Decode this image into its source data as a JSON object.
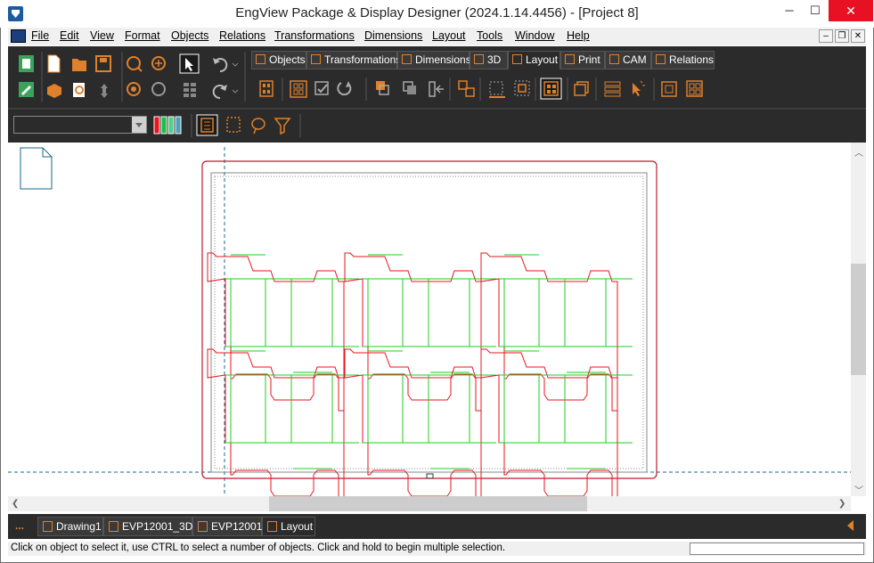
{
  "window": {
    "title": "EngView Package & Display Designer (2024.1.14.4456) - [Project 8]",
    "minimize": "─",
    "maximize": "☐",
    "close": "✕"
  },
  "menu": {
    "items": [
      "File",
      "Edit",
      "View",
      "Format",
      "Objects",
      "Relations",
      "Transformations",
      "Dimensions",
      "Layout",
      "Tools",
      "Window",
      "Help"
    ],
    "mdi_minimize": "–",
    "mdi_restore": "❐",
    "mdi_close": "✕"
  },
  "ribbon_tabs": [
    {
      "label": "Objects"
    },
    {
      "label": "Transformations"
    },
    {
      "label": "Dimensions"
    },
    {
      "label": "3D"
    },
    {
      "label": "Layout"
    },
    {
      "label": "Print"
    },
    {
      "label": "CAM"
    },
    {
      "label": "Relations"
    }
  ],
  "active_ribbon_tab": "Layout",
  "layer_select": {
    "value": ""
  },
  "doc_tabs": [
    {
      "label": "Drawing1"
    },
    {
      "label": "EVP12001_3D"
    },
    {
      "label": "EVP12001"
    },
    {
      "label": "Layout"
    }
  ],
  "doc_tabs_more": "...",
  "active_doc_tab": "Layout",
  "status": {
    "text": "Click on object to select it, use CTRL to select a number of objects. Click and hold to begin multiple selection."
  },
  "colors": {
    "toolbar_bg": "#2b2b2b",
    "accent": "#e0802a",
    "cut_line": "#e8141e",
    "crease_line": "#22cc22",
    "guide_line": "#1a6a8a"
  },
  "icons": [
    "new-file-icon",
    "open-folder-icon",
    "save-icon",
    "zoom-icon",
    "zoom-extents-icon",
    "select-arrow-icon",
    "undo-icon",
    "redo-icon"
  ]
}
